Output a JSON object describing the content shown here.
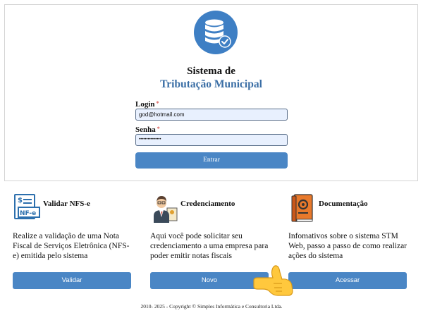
{
  "header": {
    "title_line1": "Sistema de",
    "title_line2": "Tributação Municipal"
  },
  "login_form": {
    "login_label": "Login",
    "login_value": "god@hotmail.com",
    "password_label": "Senha",
    "password_value": "•••••••••••••••",
    "required_marker": "*",
    "submit_label": "Entrar"
  },
  "cards": [
    {
      "title": "Validar NFS-e",
      "description": "Realize a validação de uma Nota Fiscal de Serviços Eletrônica (NFS-e) emitida pelo sistema",
      "button_label": "Validar",
      "icon": "nfse-document-icon",
      "icon_text": "NF-e"
    },
    {
      "title": "Credenciamento",
      "description": "Aqui você pode solicitar seu credenciamento a uma empresa para poder emitir notas fiscais",
      "button_label": "Novo",
      "icon": "businessman-icon"
    },
    {
      "title": "Documentação",
      "description": "Infomativos sobre o sistema STM Web, passo a passo de como realizar ações do sistema",
      "button_label": "Acessar",
      "icon": "manual-book-icon"
    }
  ],
  "footer": {
    "copyright": "2010- 2025 - Copyright © Simples Informática e Consultoria Ltda."
  },
  "colors": {
    "primary": "#4a86c5",
    "title_blue": "#3a6ea5",
    "logo_blue": "#3e7fc4",
    "input_bg": "#e8f0fe",
    "required": "#d9534f"
  }
}
